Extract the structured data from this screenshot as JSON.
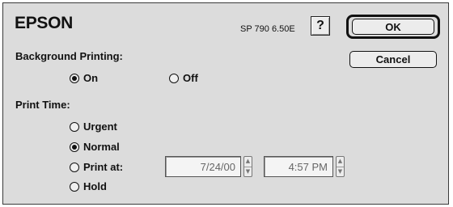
{
  "header": {
    "brand": "EPSON",
    "version": "SP 790 6.50E",
    "help_label": "?"
  },
  "buttons": {
    "ok": "OK",
    "cancel": "Cancel"
  },
  "background_printing": {
    "label": "Background Printing:",
    "options": [
      {
        "label": "On",
        "selected": true
      },
      {
        "label": "Off",
        "selected": false
      }
    ]
  },
  "print_time": {
    "label": "Print Time:",
    "options": [
      {
        "label": "Urgent",
        "selected": false
      },
      {
        "label": "Normal",
        "selected": true
      },
      {
        "label": "Print at:",
        "selected": false
      },
      {
        "label": "Hold",
        "selected": false
      }
    ],
    "date_value": "7/24/00",
    "time_value": "4:57 PM"
  },
  "icons": {
    "stepper_up": "triangle-up-icon",
    "stepper_down": "triangle-down-icon"
  }
}
